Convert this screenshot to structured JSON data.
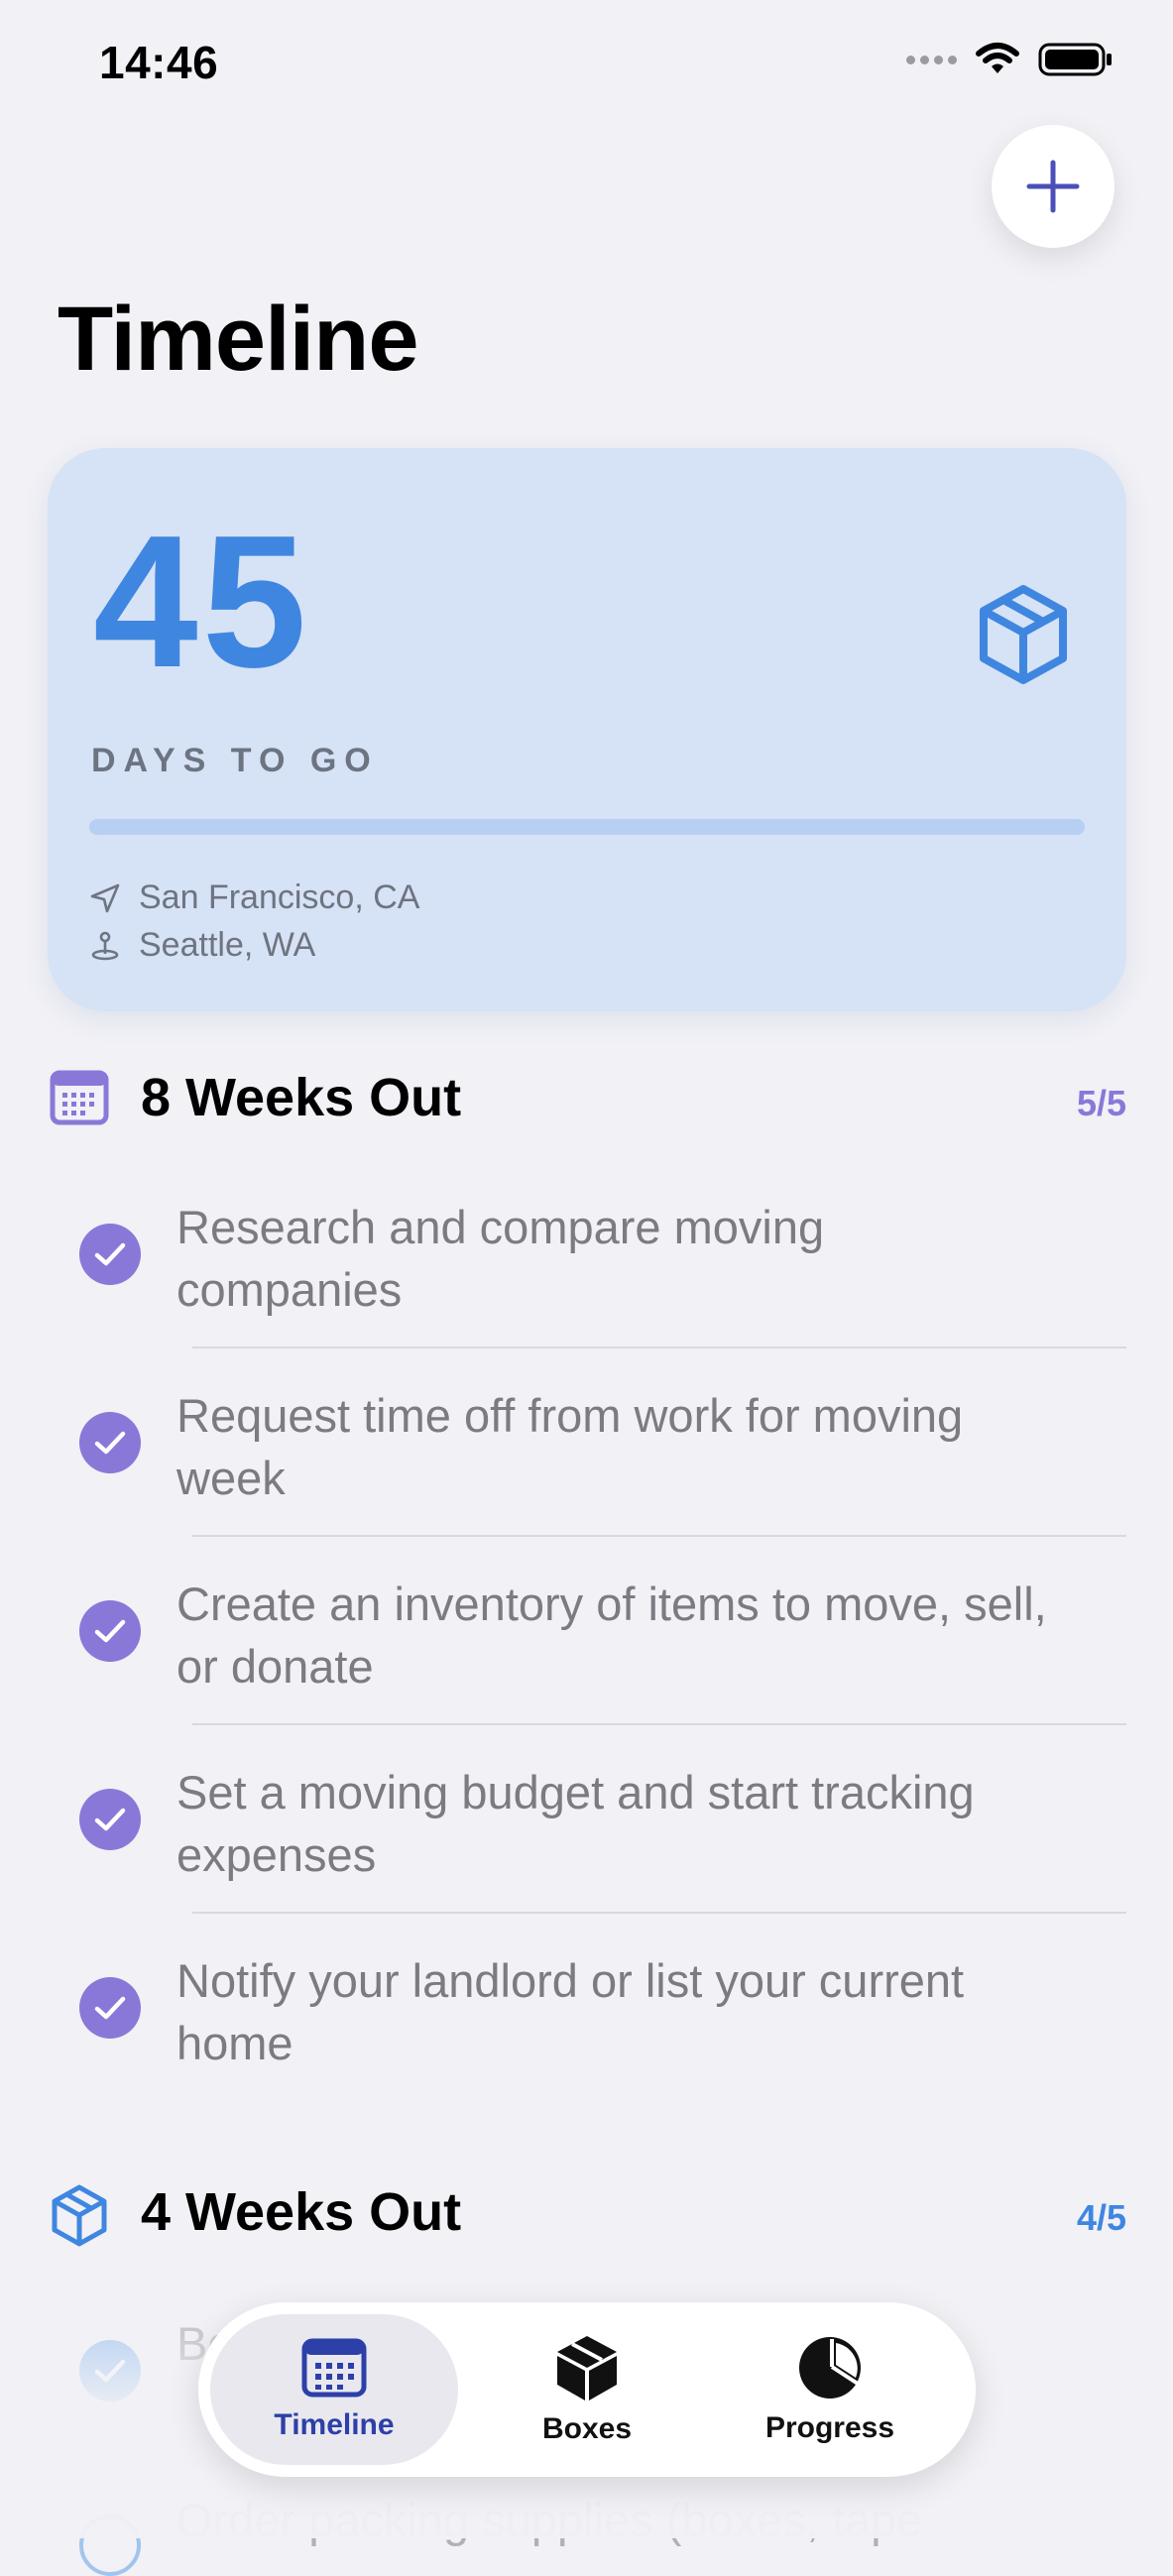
{
  "status_bar": {
    "time": "14:46"
  },
  "header": {
    "title": "Timeline",
    "add_icon": "plus-icon"
  },
  "hero": {
    "days_number": "45",
    "days_label": "DAYS TO GO",
    "progress_fraction": 0.0,
    "from_city": "San Francisco, CA",
    "to_city": "Seattle, WA",
    "icon": "package-icon"
  },
  "sections": [
    {
      "title": "8 Weeks Out",
      "count": "5/5",
      "icon": "calendar-icon",
      "accent": "#8a78d8",
      "tasks": [
        {
          "text": "Research and compare moving companies",
          "done": true
        },
        {
          "text": "Request time off from work for moving week",
          "done": true
        },
        {
          "text": "Create an inventory of items to move, sell, or donate",
          "done": true
        },
        {
          "text": "Set a moving budget and start tracking expenses",
          "done": true
        },
        {
          "text": "Notify your landlord or list your current home",
          "done": true
        }
      ]
    },
    {
      "title": "4 Weeks Out",
      "count": "4/5",
      "icon": "package-icon",
      "accent": "#3f86e0",
      "tasks": [
        {
          "text": "Bo",
          "done": true
        },
        {
          "text": "Order packing supplies (boxes, tape",
          "done": false
        }
      ]
    }
  ],
  "tab_bar": {
    "tabs": [
      {
        "label": "Timeline",
        "icon": "calendar-icon",
        "selected": true
      },
      {
        "label": "Boxes",
        "icon": "cube-icon",
        "selected": false
      },
      {
        "label": "Progress",
        "icon": "pie-chart-icon",
        "selected": false
      }
    ]
  },
  "colors": {
    "background": "#f1f1f6",
    "hero_card": "#d6e2f5",
    "hero_accent": "#3f86e0",
    "tab_selected": "#2d3fa8",
    "add_button_icon": "#4a50b8"
  }
}
